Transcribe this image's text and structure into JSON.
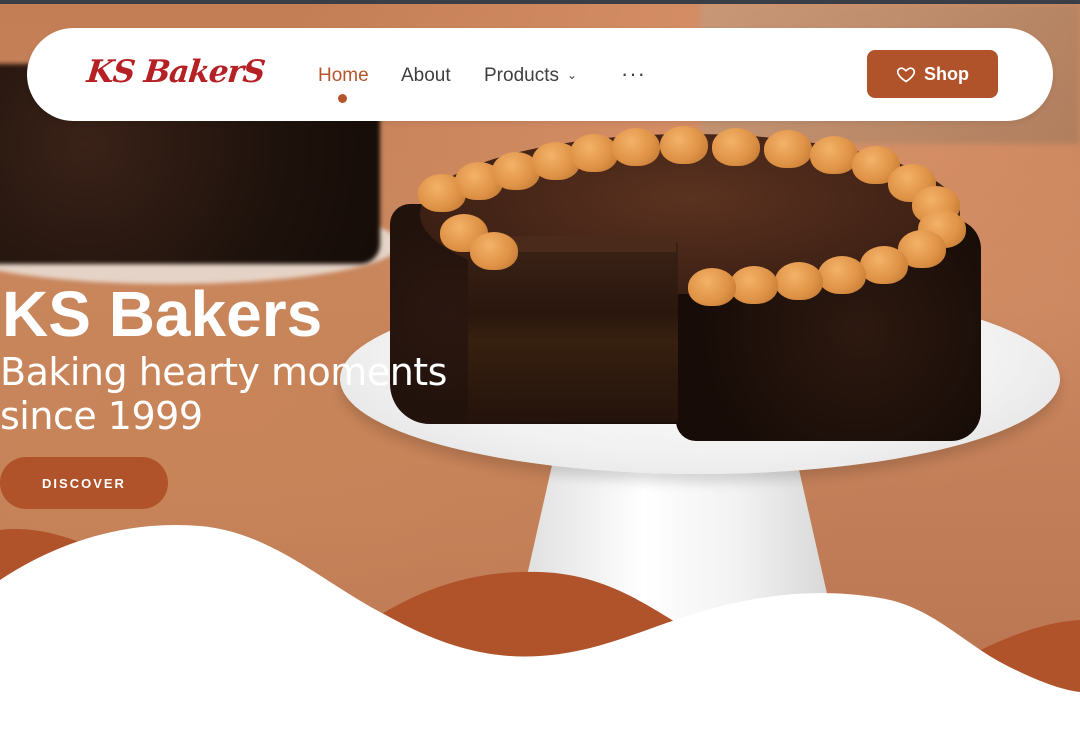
{
  "brand": {
    "logo_text": "KS BakerS"
  },
  "nav": {
    "items": [
      {
        "label": "Home",
        "active": true
      },
      {
        "label": "About"
      },
      {
        "label": "Products",
        "has_dropdown": true
      }
    ],
    "more_label": "···",
    "shop_label": "Shop",
    "shop_icon": "heart-icon"
  },
  "hero": {
    "title": "KS Bakers",
    "subtitle": "Baking hearty moments since 1999",
    "cta_label": "DISCOVER"
  },
  "colors": {
    "accent": "#b0532a",
    "logo_red": "#b52025",
    "nav_text": "#3f3f3f",
    "background_tan": "#c47e56"
  }
}
